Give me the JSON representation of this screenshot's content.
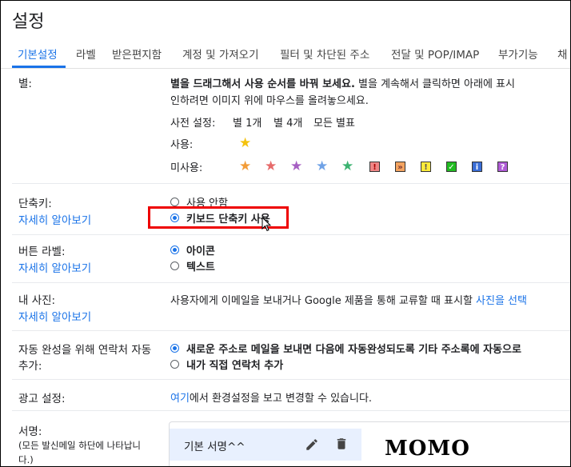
{
  "header": {
    "title": "설정"
  },
  "tabs": [
    {
      "label": "기본설정"
    },
    {
      "label": "라벨"
    },
    {
      "label": "받은편지함"
    },
    {
      "label": "계정 및 가져오기"
    },
    {
      "label": "필터 및 차단된 주소"
    },
    {
      "label": "전달 및 POP/IMAP"
    },
    {
      "label": "부가기능"
    },
    {
      "label": "채"
    }
  ],
  "stars": {
    "label": "별:",
    "desc_bold": "별을 드래그해서 사용 순서를 바꿔 보세요.",
    "desc_rest": "별을 계속해서 클릭하면 아래에 표시",
    "desc_line2": "인하려면 이미지 위에 마우스를 올려놓으세요.",
    "presets_label": "사전 설정:",
    "presets": [
      "별 1개",
      "별 4개",
      "모든 별표"
    ],
    "in_use_label": "사용:",
    "not_in_use_label": "미사용:",
    "badges": [
      "!",
      "»",
      "!",
      "✓",
      "i",
      "?"
    ]
  },
  "shortcuts": {
    "label": "단축키:",
    "learn_more": "자세히 알아보기",
    "off": "사용 안함",
    "on": "키보드 단축키 사용"
  },
  "button_labels": {
    "label": "버튼 라벨:",
    "learn_more": "자세히 알아보기",
    "icons": "아이콘",
    "text": "텍스트"
  },
  "my_picture": {
    "label": "내 사진:",
    "learn_more": "자세히 알아보기",
    "desc": "사용자에게 이메일을 보내거나 Google 제품을 통해 교류할 때 표시할",
    "desc_link": "사진을 선택"
  },
  "autocomplete": {
    "label_line1": "자동 완성을 위해 연락처 자동",
    "label_line2": "추가:",
    "opt1": "새로운 주소로 메일을 보내면 다음에 자동완성되도록 기타 주소록에 자동으로",
    "opt2": "내가 직접 연락처 추가"
  },
  "ads": {
    "label": "광고 설정:",
    "link": "여기",
    "desc": "에서 환경설정을 보고 변경할 수 있습니다."
  },
  "signature": {
    "label": "서명:",
    "note_line1": "(모든 발신메일 하단에 나타납니",
    "note_line2": "다.)",
    "item": "기본 서명^^"
  },
  "watermark": "MOMO"
}
